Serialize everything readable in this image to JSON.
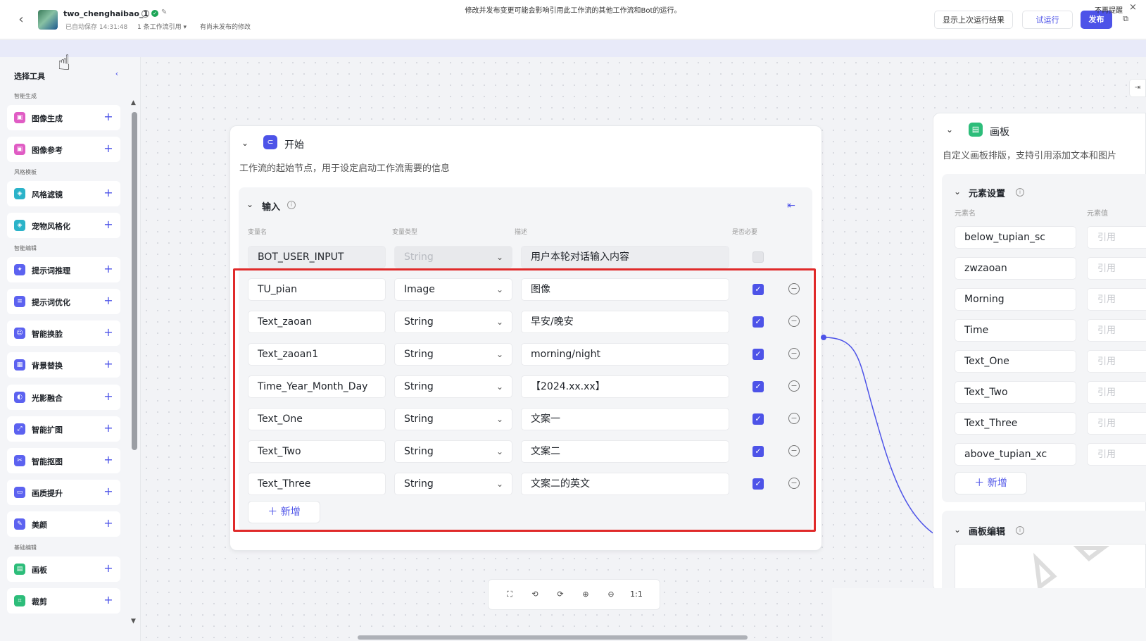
{
  "header": {
    "workflow_name": "two_chenghaibao_1",
    "autosave": "已自动保存 14:31:48",
    "ref_count": "1 条工作流引用 ▾",
    "unpublished": "有尚未发布的修改",
    "show_last_run": "显示上次运行结果",
    "try_run": "试运行",
    "publish": "发布"
  },
  "banner": {
    "text": "修改并发布变更可能会影响引用此工作流的其他工作流和Bot的运行。",
    "dismiss": "不再提醒"
  },
  "sidebar": {
    "title": "选择工具",
    "categories": [
      "智能生成",
      "风格模板",
      "智能编辑",
      "基础编辑"
    ],
    "tools": [
      {
        "label": "图像生成",
        "color": "#e05cc4"
      },
      {
        "label": "图像参考",
        "color": "#e05cc4"
      },
      {
        "label": "风格滤镜",
        "color": "#2bb3c9"
      },
      {
        "label": "宠物风格化",
        "color": "#2bb3c9"
      },
      {
        "label": "提示词推理",
        "color": "#5c62f0"
      },
      {
        "label": "提示词优化",
        "color": "#5c62f0"
      },
      {
        "label": "智能换脸",
        "color": "#5c62f0"
      },
      {
        "label": "背景替换",
        "color": "#5c62f0"
      },
      {
        "label": "光影融合",
        "color": "#5c62f0"
      },
      {
        "label": "智能扩图",
        "color": "#5c62f0"
      },
      {
        "label": "智能抠图",
        "color": "#5c62f0"
      },
      {
        "label": "画质提升",
        "color": "#5c62f0"
      },
      {
        "label": "美颜",
        "color": "#5c62f0"
      },
      {
        "label": "画板",
        "color": "#2dbd7a"
      },
      {
        "label": "裁剪",
        "color": "#2dbd7a"
      }
    ]
  },
  "start_node": {
    "title": "开始",
    "description": "工作流的起始节点，用于设定启动工作流需要的信息",
    "input_title": "输入",
    "columns": [
      "变量名",
      "变量类型",
      "描述",
      "是否必要"
    ],
    "fixed_row": {
      "name": "BOT_USER_INPUT",
      "type": "String",
      "desc": "用户本轮对话输入内容"
    },
    "rows": [
      {
        "name": "TU_pian",
        "type": "Image",
        "desc": "图像"
      },
      {
        "name": "Text_zaoan",
        "type": "String",
        "desc": "早安/晚安"
      },
      {
        "name": "Text_zaoan1",
        "type": "String",
        "desc": "morning/night"
      },
      {
        "name": "Time_Year_Month_Day",
        "type": "String",
        "desc": "【2024.xx.xx】"
      },
      {
        "name": "Text_One",
        "type": "String",
        "desc": "文案一"
      },
      {
        "name": "Text_Two",
        "type": "String",
        "desc": "文案二"
      },
      {
        "name": "Text_Three",
        "type": "String",
        "desc": "文案二的英文"
      }
    ],
    "add_label": "新增"
  },
  "board_node": {
    "title": "画板",
    "description": "自定义画板排版，支持引用添加文本和图片",
    "element_settings_title": "元素设置",
    "columns": [
      "元素名",
      "元素值"
    ],
    "elements": [
      {
        "name": "below_tupian_sc",
        "ref": "引用"
      },
      {
        "name": "zwzaoan",
        "ref": "引用"
      },
      {
        "name": "Morning",
        "ref": "引用"
      },
      {
        "name": "Time",
        "ref": "引用"
      },
      {
        "name": "Text_One",
        "ref": "引用"
      },
      {
        "name": "Text_Two",
        "ref": "引用"
      },
      {
        "name": "Text_Three",
        "ref": "引用"
      },
      {
        "name": "above_tupian_xc",
        "ref": "引用"
      }
    ],
    "add_label": "新增",
    "board_edit_title": "画板编辑"
  },
  "zoom_toolbar": {
    "items": [
      "fit-view-icon",
      "rotate-left-icon",
      "rotate-right-icon",
      "zoom-in-icon",
      "zoom-out-icon",
      "actual-size-icon"
    ],
    "ratio": "1:1"
  },
  "colors": {
    "accent": "#4d53e8",
    "highlight": "#e02a2a"
  }
}
